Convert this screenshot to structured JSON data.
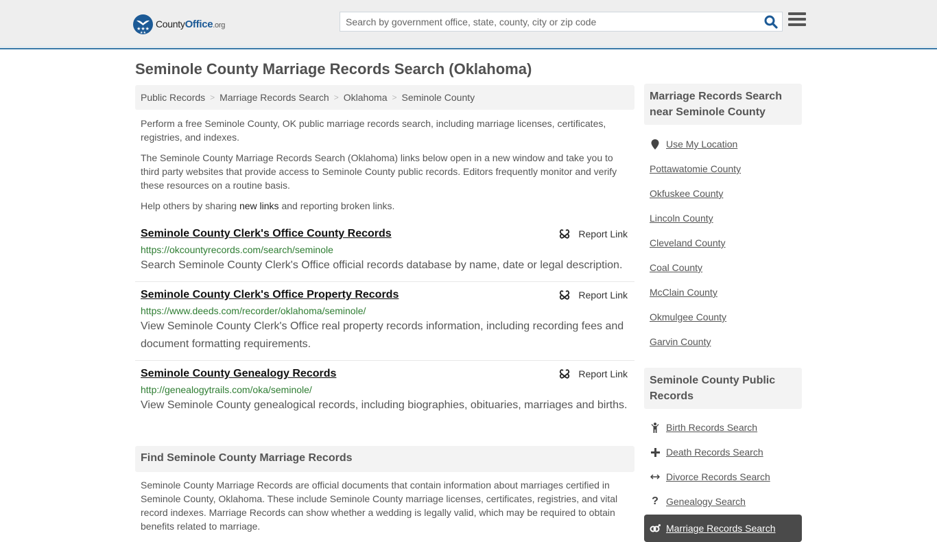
{
  "header": {
    "logo": {
      "name_main": "County",
      "name_brand": "Office",
      "name_tld": ".org"
    },
    "search": {
      "placeholder": "Search by government office, state, county, city or zip code",
      "value": ""
    },
    "icons": {
      "search": "search-icon",
      "menu": "hamburger-menu-icon"
    }
  },
  "page": {
    "title": "Seminole County Marriage Records Search (Oklahoma)"
  },
  "breadcrumb": [
    {
      "label": "Public Records"
    },
    {
      "label": "Marriage Records Search"
    },
    {
      "label": "Oklahoma"
    },
    {
      "label": "Seminole County"
    }
  ],
  "breadcrumb_separator": ">",
  "intro": {
    "p1": "Perform a free Seminole County, OK public marriage records search, including marriage licenses, certificates, registries, and indexes.",
    "p2": "The Seminole County Marriage Records Search (Oklahoma) links below open in a new window and take you to third party websites that provide access to Seminole County public records. Editors frequently monitor and verify these resources on a routine basis.",
    "p3_before": "Help others by sharing ",
    "p3_link": "new links",
    "p3_after": " and reporting broken links."
  },
  "report_label": "Report Link",
  "links": [
    {
      "title": "Seminole County Clerk's Office County Records",
      "url": "https://okcountyrecords.com/search/seminole",
      "description": "Search Seminole County Clerk's Office official records database by name, date or legal description."
    },
    {
      "title": "Seminole County Clerk's Office Property Records",
      "url": "https://www.deeds.com/recorder/oklahoma/seminole/",
      "description": "View Seminole County Clerk's Office real property records information, including recording fees and document formatting requirements."
    },
    {
      "title": "Seminole County Genealogy Records",
      "url": "http://genealogytrails.com/oka/seminole/",
      "description": "View Seminole County genealogical records, including biographies, obituaries, marriages and births."
    }
  ],
  "find_section": {
    "heading": "Find Seminole County Marriage Records",
    "body": "Seminole County Marriage Records are official documents that contain information about marriages certified in Seminole County, Oklahoma. These include Seminole County marriage licenses, certificates, registries, and vital record indexes. Marriage Records can show whether a wedding is legally valid, which may be required to obtain benefits related to marriage."
  },
  "sidebar": {
    "nearby": {
      "heading": "Marriage Records Search near Seminole County",
      "use_location": "Use My Location",
      "counties": [
        "Pottawatomie County",
        "Okfuskee County",
        "Lincoln County",
        "Cleveland County",
        "Coal County",
        "McClain County",
        "Okmulgee County",
        "Garvin County"
      ]
    },
    "public_records": {
      "heading": "Seminole County Public Records",
      "items": [
        {
          "label": "Birth Records Search",
          "icon": "child-icon"
        },
        {
          "label": "Death Records Search",
          "icon": "cross-icon"
        },
        {
          "label": "Divorce Records Search",
          "icon": "arrows-horizontal-icon"
        },
        {
          "label": "Genealogy Search",
          "icon": "question-icon"
        }
      ],
      "active_item": {
        "label": "Marriage Records Search",
        "icon": "marriage-symbol-icon"
      }
    }
  },
  "colors": {
    "brand_blue": "#1c5a96",
    "header_border": "#3a7aa8",
    "url_green": "#2e7d32",
    "active_bg": "#4a4a4a"
  }
}
